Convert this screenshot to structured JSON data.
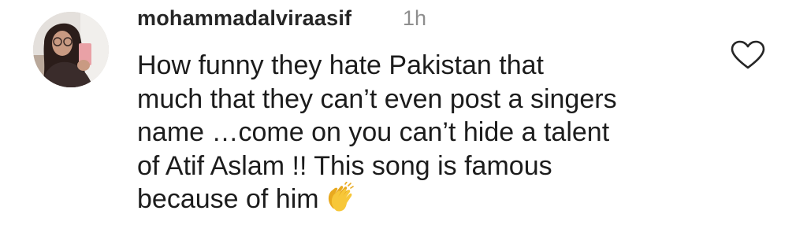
{
  "comment": {
    "username": "mohammadalviraasif",
    "timestamp": "1h",
    "text_lines": [
      "How funny they  hate Pakistan that",
      "much that they can’t even post a singers",
      "name …come on you can’t hide a talent",
      "of Atif Aslam !! This song is famous",
      "because of him"
    ],
    "emoji": "clapping-hands"
  },
  "icons": {
    "like": "heart-outline-icon"
  },
  "colors": {
    "username": "#262626",
    "timestamp": "#8e8e8e",
    "text": "#1c1c1c",
    "emoji": "#f4c233"
  }
}
